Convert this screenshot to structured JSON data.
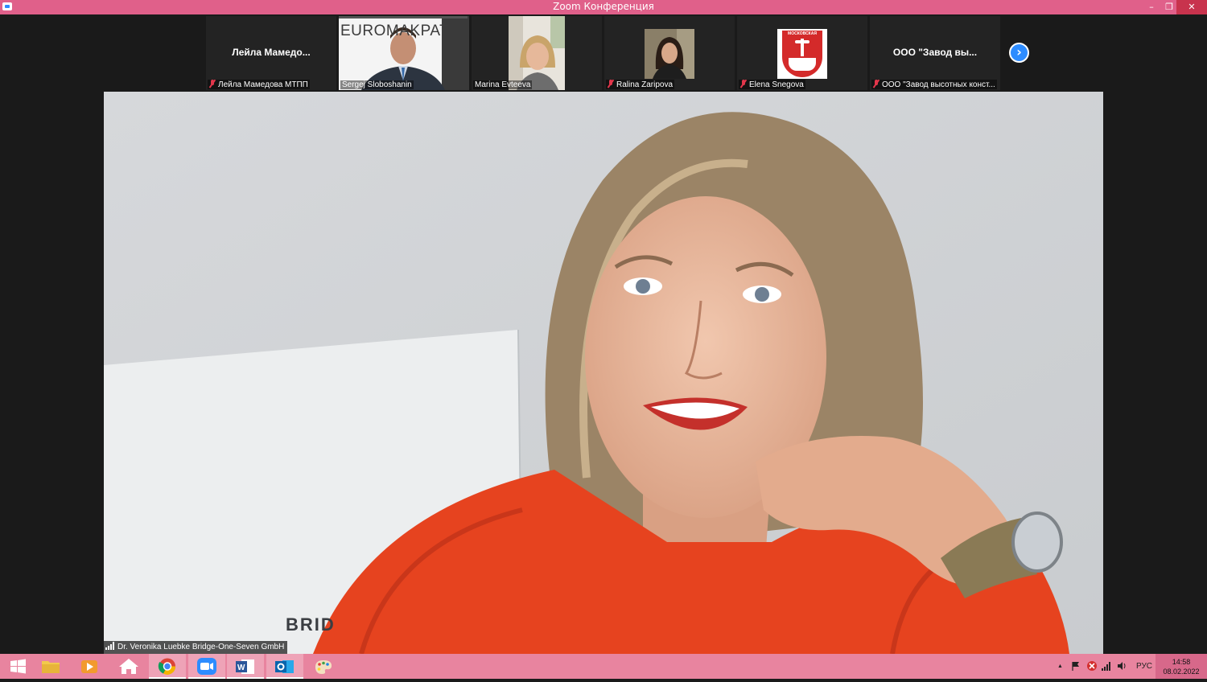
{
  "window": {
    "title": "Zoom Конференция",
    "min_glyph": "–",
    "max_glyph": "❐",
    "close_glyph": "✕"
  },
  "gallery": {
    "tiles": [
      {
        "big_name": "Лейла  Мамедо...",
        "label": "Лейла Мамедова МТПП",
        "muted": true
      },
      {
        "label": "Sergej Sloboshanin",
        "muted": false,
        "banner_text": "EUROMAKPAT"
      },
      {
        "label": "Marina Evteeva",
        "muted": false
      },
      {
        "label": "Ralina Zaripova",
        "muted": true
      },
      {
        "label": "Elena Snegova",
        "muted": true,
        "logo_text": "МОСКОВСКАЯ"
      },
      {
        "big_name": "ООО  \"Завод  вы...",
        "label": "ООО \"Завод высотных конст...",
        "muted": true
      }
    ],
    "next_glyph": "›"
  },
  "main_video": {
    "speaker_label": "Dr. Veronika Luebke Bridge-One-Seven GmbH",
    "wall_text": "BRID"
  },
  "taskbar": {
    "tray_language": "РУС",
    "tray_up_glyph": "▲",
    "clock_time": "14:58",
    "clock_date": "08.02.2022"
  },
  "colors": {
    "accent": "#2d8cff",
    "titlebar": "#e0608a",
    "taskbar": "#e8849f",
    "mute": "#e2364b"
  }
}
